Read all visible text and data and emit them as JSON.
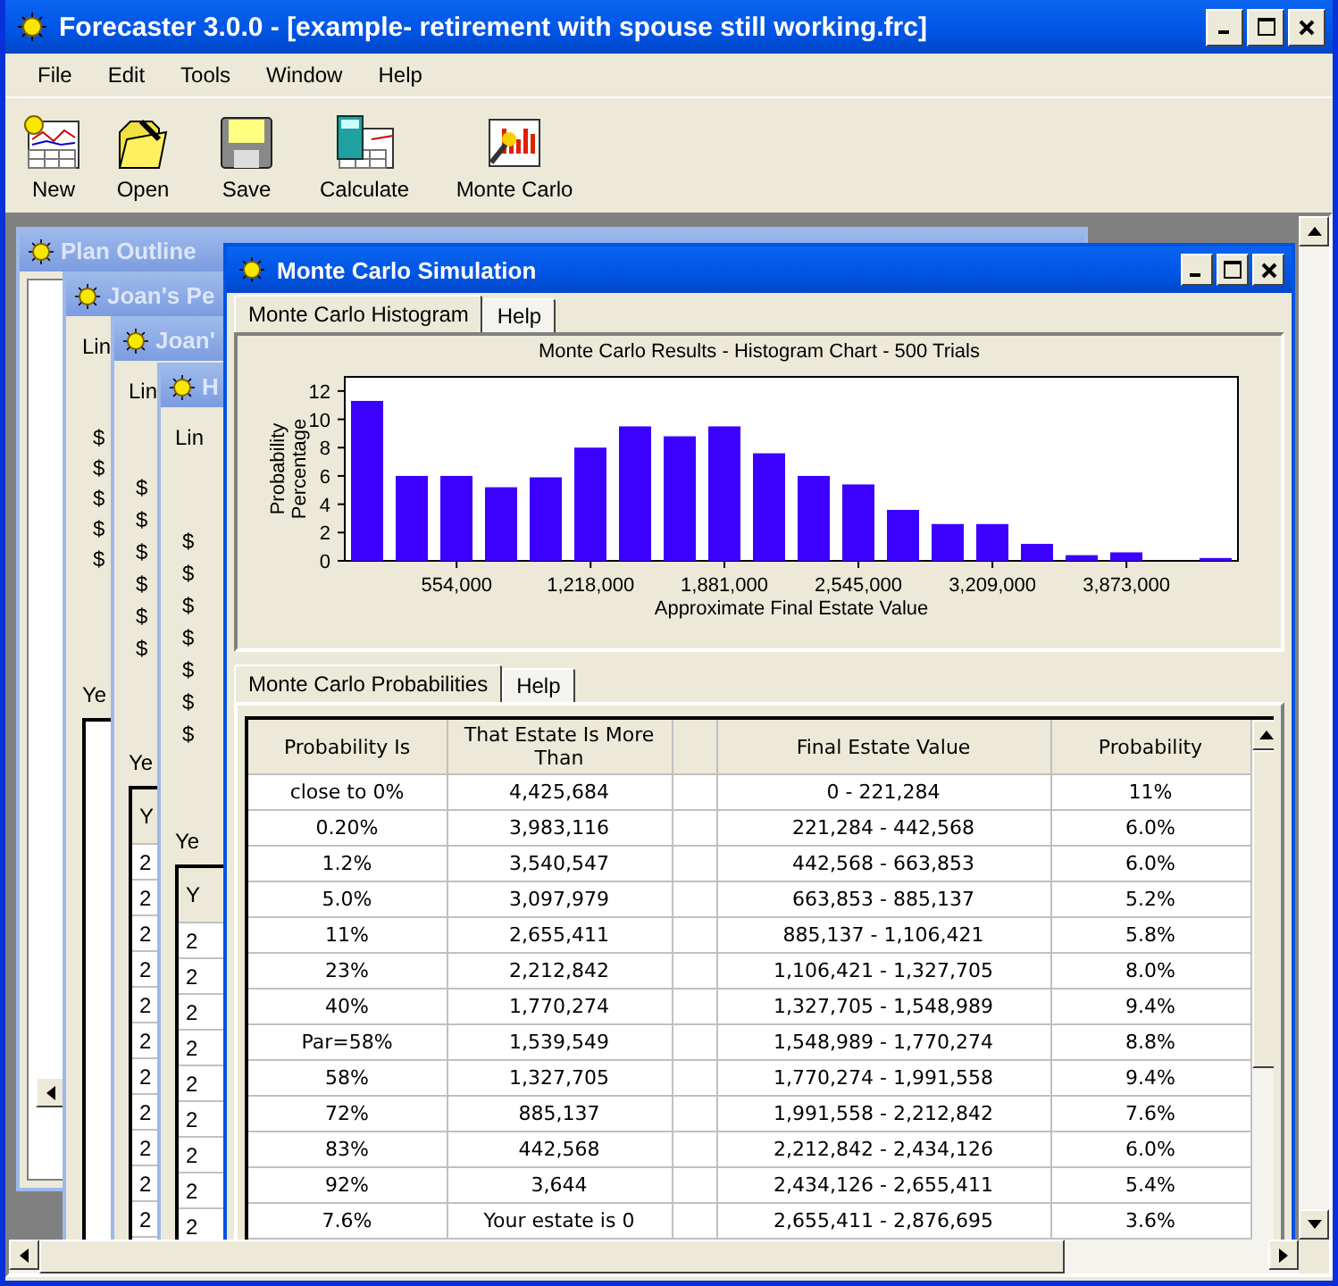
{
  "window": {
    "title": "Forecaster 3.0.0 - [example- retirement with spouse still working.frc]"
  },
  "menu": [
    "File",
    "Edit",
    "Tools",
    "Window",
    "Help"
  ],
  "toolbar": [
    {
      "kind": "new",
      "label": "New"
    },
    {
      "kind": "open",
      "label": "Open"
    },
    {
      "kind": "save",
      "label": "Save"
    },
    {
      "kind": "calculate",
      "label": "Calculate"
    },
    {
      "kind": "montecarlo",
      "label": "Monte Carlo"
    }
  ],
  "background_windows": [
    {
      "title": "Plan Outline"
    },
    {
      "title": "Joan's Pe",
      "line_label": "Lin",
      "amounts": [
        "$",
        "$",
        "$",
        "$",
        "$"
      ],
      "year_label": "Ye"
    },
    {
      "title": "Joan'",
      "line_label": "Lin",
      "amounts": [
        "$",
        "$",
        "$",
        "$",
        "$",
        "$"
      ],
      "year_label": "Ye",
      "year_header": "Y",
      "year_cells": [
        "2",
        "2",
        "2",
        "2",
        "2",
        "2",
        "2",
        "2",
        "2",
        "2",
        "2"
      ]
    },
    {
      "title": "H",
      "line_label": "Lin",
      "amounts": [
        "$",
        "$",
        "$",
        "$",
        "$",
        "$",
        "$"
      ],
      "year_label": "Ye",
      "year_header": "Y",
      "year_cells": [
        "2",
        "2",
        "2",
        "2",
        "2",
        "2",
        "2",
        "2",
        "2"
      ]
    }
  ],
  "simulation": {
    "title": "Monte Carlo Simulation",
    "chart_tabs": [
      {
        "label": "Monte Carlo Histogram",
        "selected": true
      },
      {
        "label": "Help",
        "selected": false
      }
    ],
    "chart_data": {
      "type": "bar",
      "title": "Monte Carlo Results - Histogram Chart - 500 Trials",
      "xlabel": "Approximate Final Estate Value",
      "ylabel": "Probability Percentage",
      "x": [
        110642,
        331926,
        553210,
        774495,
        995779,
        1217063,
        1438347,
        1659631,
        1880916,
        2102200,
        2323484,
        2544768,
        2766053,
        2987337,
        3208621,
        3429905,
        3651189,
        3872474,
        4093758,
        4315042
      ],
      "values": [
        11.3,
        6,
        6,
        5.2,
        5.9,
        8,
        9.5,
        8.8,
        9.5,
        7.6,
        6,
        5.4,
        3.6,
        2.6,
        2.6,
        1.2,
        0.4,
        0.6,
        0,
        0.2
      ],
      "xlim": [
        0,
        4425684
      ],
      "ylim": [
        0,
        13
      ],
      "xticks": [
        {
          "value": 554000,
          "label": "554,000"
        },
        {
          "value": 1218000,
          "label": "1,218,000"
        },
        {
          "value": 1881000,
          "label": "1,881,000"
        },
        {
          "value": 2545000,
          "label": "2,545,000"
        },
        {
          "value": 3209000,
          "label": "3,209,000"
        },
        {
          "value": 3873000,
          "label": "3,873,000"
        }
      ],
      "yticks": [
        0,
        2,
        4,
        6,
        8,
        10,
        12
      ]
    },
    "table_tabs": [
      {
        "label": "Monte Carlo Probabilities",
        "selected": true
      },
      {
        "label": "Help",
        "selected": false
      }
    ],
    "table": {
      "columns": [
        "Probability Is",
        "That Estate Is More Than",
        "",
        "Final Estate Value",
        "Probability"
      ],
      "rows": [
        [
          "close to 0%",
          "4,425,684",
          "",
          "0 - 221,284",
          "11%"
        ],
        [
          "0.20%",
          "3,983,116",
          "",
          "221,284 - 442,568",
          "6.0%"
        ],
        [
          "1.2%",
          "3,540,547",
          "",
          "442,568 - 663,853",
          "6.0%"
        ],
        [
          "5.0%",
          "3,097,979",
          "",
          "663,853 - 885,137",
          "5.2%"
        ],
        [
          "11%",
          "2,655,411",
          "",
          "885,137 - 1,106,421",
          "5.8%"
        ],
        [
          "23%",
          "2,212,842",
          "",
          "1,106,421 - 1,327,705",
          "8.0%"
        ],
        [
          "40%",
          "1,770,274",
          "",
          "1,327,705 - 1,548,989",
          "9.4%"
        ],
        [
          "Par=58%",
          "1,539,549",
          "",
          "1,548,989 - 1,770,274",
          "8.8%"
        ],
        [
          "58%",
          "1,327,705",
          "",
          "1,770,274 - 1,991,558",
          "9.4%"
        ],
        [
          "72%",
          "885,137",
          "",
          "1,991,558 - 2,212,842",
          "7.6%"
        ],
        [
          "83%",
          "442,568",
          "",
          "2,212,842 - 2,434,126",
          "6.0%"
        ],
        [
          "92%",
          "3,644",
          "",
          "2,434,126 - 2,655,411",
          "5.4%"
        ],
        [
          "7.6%",
          "Your estate is 0",
          "",
          "2,655,411 - 2,876,695",
          "3.6%"
        ]
      ]
    }
  }
}
